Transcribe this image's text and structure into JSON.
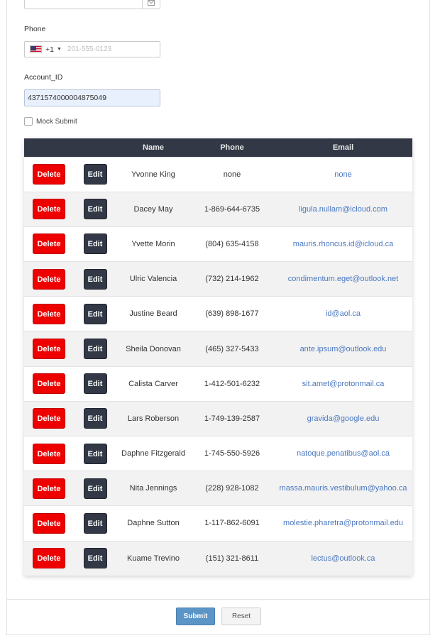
{
  "form": {
    "email": {
      "icon": "envelope-icon"
    },
    "phone": {
      "label": "Phone",
      "country_flag": "us-flag-icon",
      "dial_code": "+1",
      "placeholder": "201-555-0123",
      "value": ""
    },
    "account_id": {
      "label": "Account_ID",
      "value": "4371574000004875049"
    },
    "mock_submit": {
      "label": "Mock Submit",
      "checked": false
    }
  },
  "table": {
    "columns": [
      "",
      "",
      "Name",
      "Phone",
      "Email"
    ],
    "delete_label": "Delete",
    "edit_label": "Edit",
    "rows": [
      {
        "name": "Yvonne King",
        "phone": "none",
        "email": "none"
      },
      {
        "name": "Dacey May",
        "phone": "1-869-644-6735",
        "email": "ligula.nullam@icloud.com"
      },
      {
        "name": "Yvette Morin",
        "phone": "(804) 635-4158",
        "email": "mauris.rhoncus.id@icloud.ca"
      },
      {
        "name": "Ulric Valencia",
        "phone": "(732) 214-1962",
        "email": "condimentum.eget@outlook.net"
      },
      {
        "name": "Justine Beard",
        "phone": "(639) 898-1677",
        "email": "id@aol.ca"
      },
      {
        "name": "Sheila Donovan",
        "phone": "(465) 327-5433",
        "email": "ante.ipsum@outlook.edu"
      },
      {
        "name": "Calista Carver",
        "phone": "1-412-501-6232",
        "email": "sit.amet@protonmail.ca"
      },
      {
        "name": "Lars Roberson",
        "phone": "1-749-139-2587",
        "email": "gravida@google.edu"
      },
      {
        "name": "Daphne Fitzgerald",
        "phone": "1-745-550-5926",
        "email": "natoque.penatibus@aol.ca"
      },
      {
        "name": "Nita Jennings",
        "phone": "(228) 928-1082",
        "email": "massa.mauris.vestibulum@yahoo.ca"
      },
      {
        "name": "Daphne Sutton",
        "phone": "1-117-862-6091",
        "email": "molestie.pharetra@protonmail.edu"
      },
      {
        "name": "Kuame Trevino",
        "phone": "(151) 321-8611",
        "email": "lectus@outlook.ca"
      }
    ]
  },
  "footer": {
    "submit_label": "Submit",
    "reset_label": "Reset"
  },
  "colors": {
    "header_bg": "#323846",
    "delete": "#ee0000",
    "edit": "#323846",
    "submit": "#5b94c6",
    "link": "#4b78c2"
  }
}
